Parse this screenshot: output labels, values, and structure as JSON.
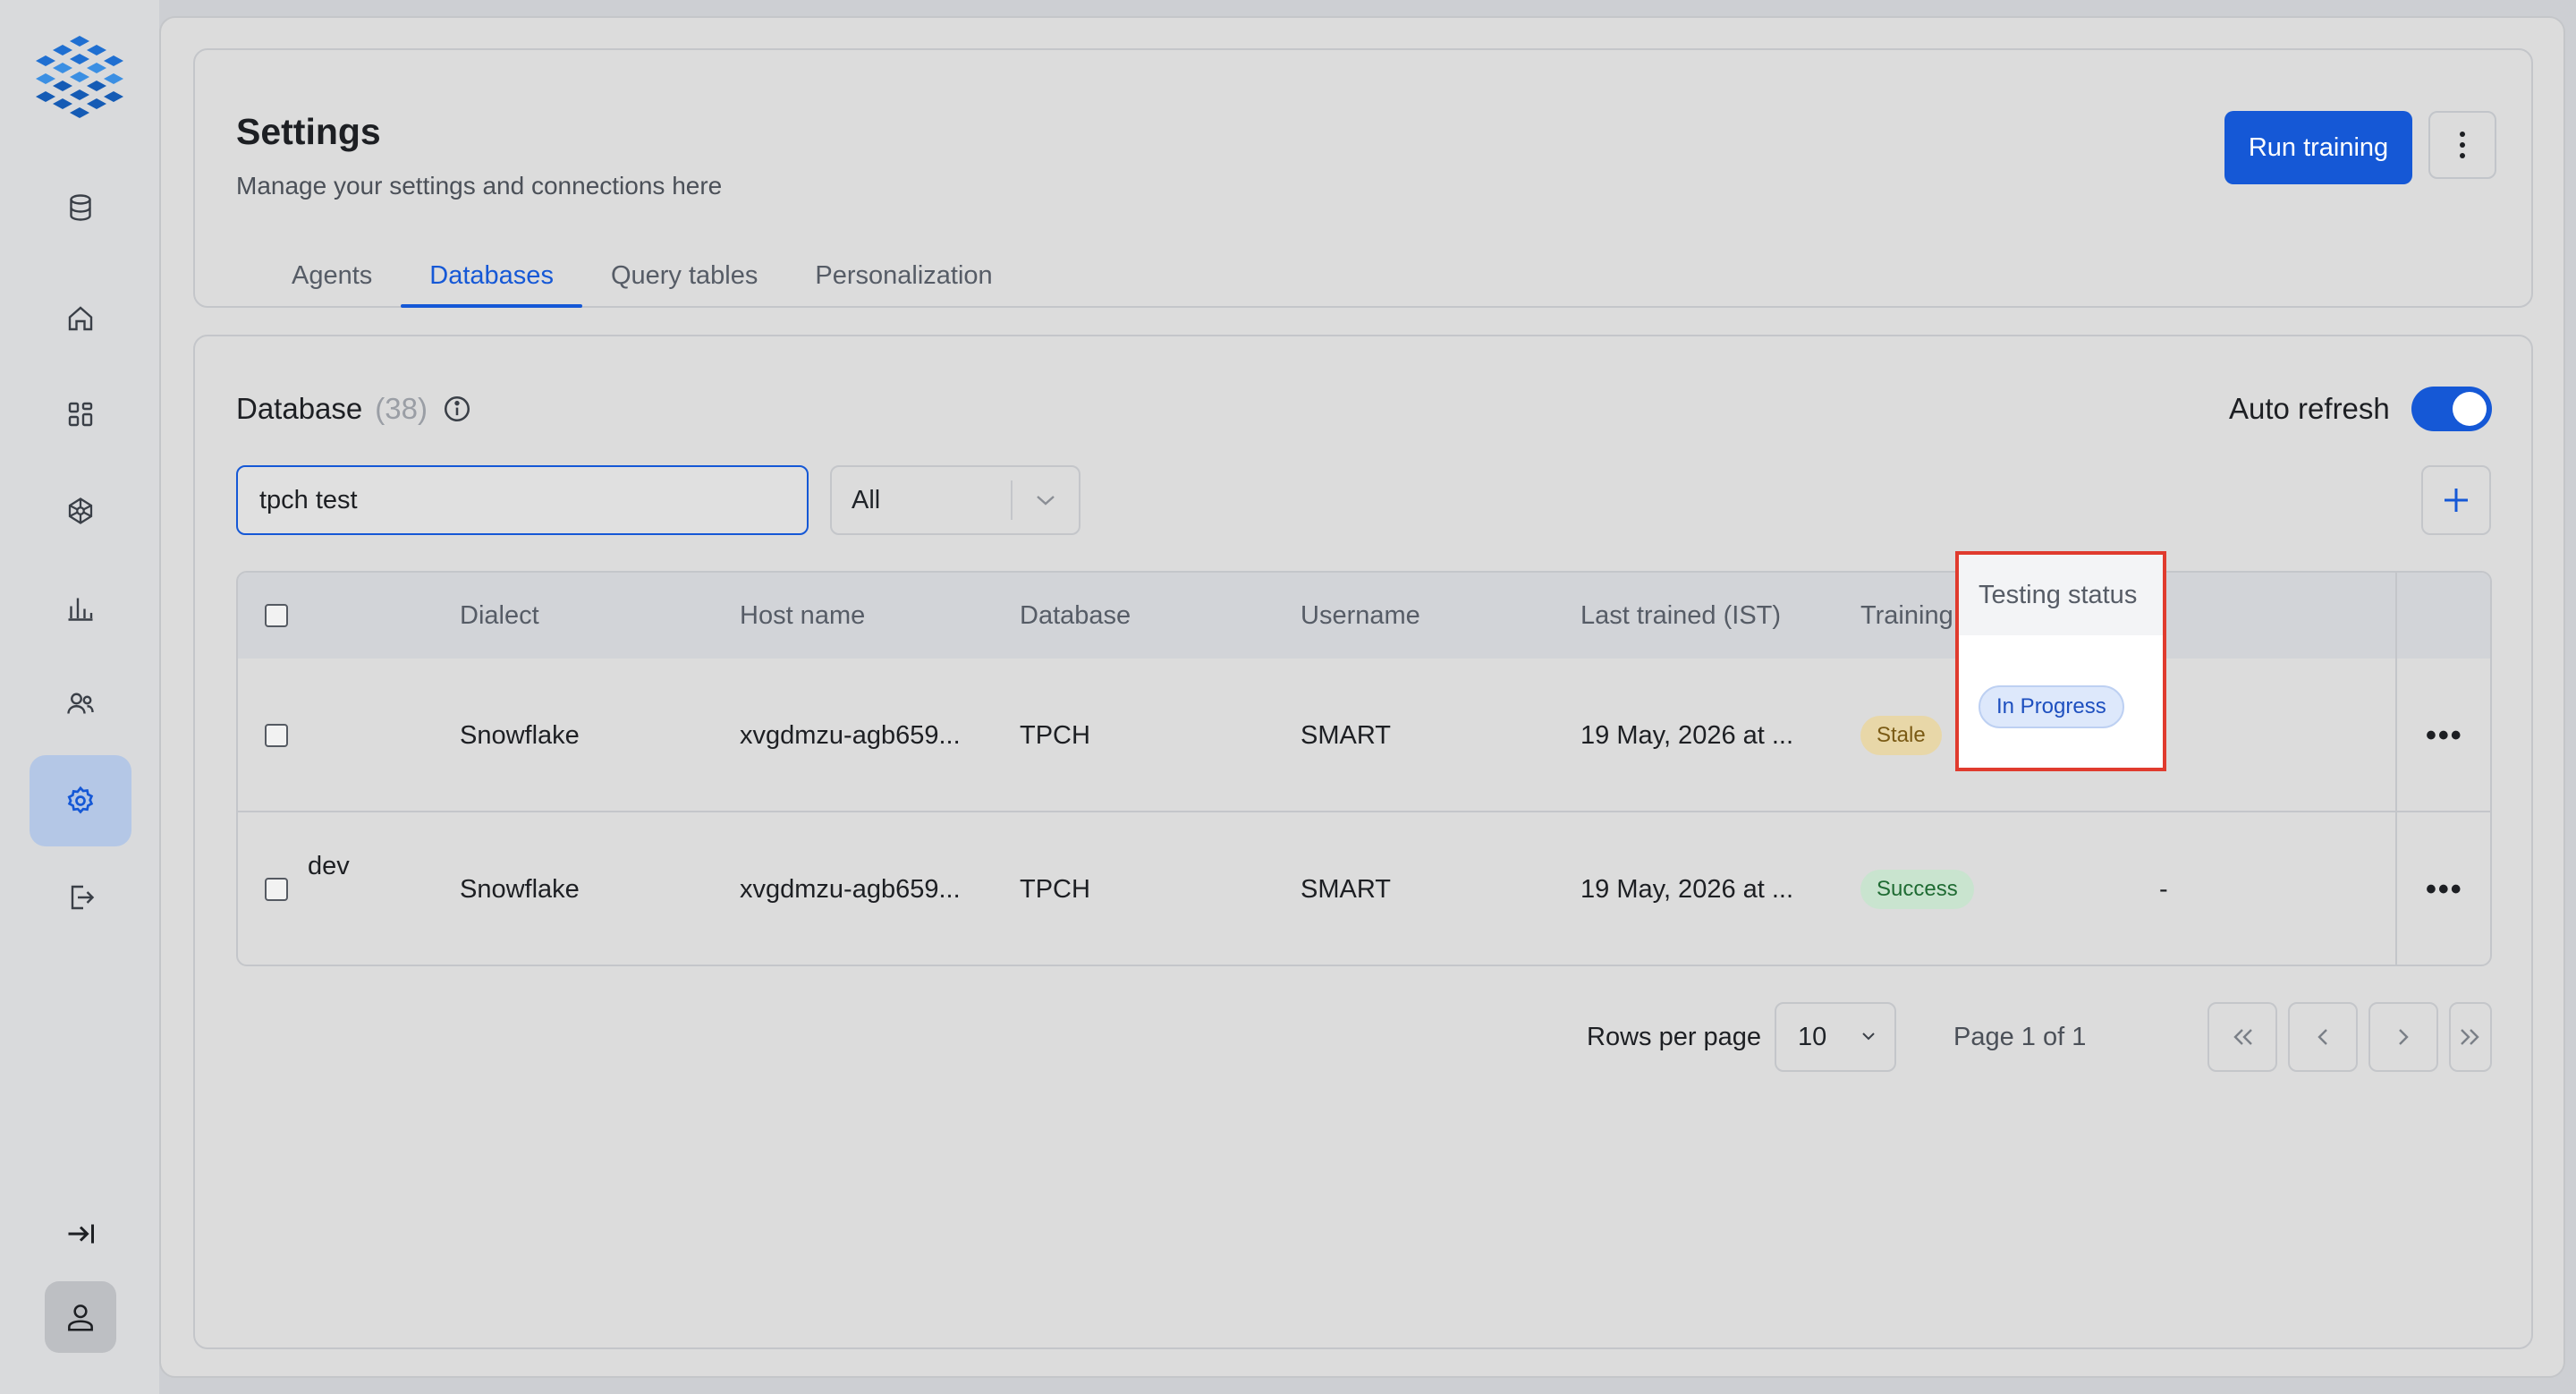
{
  "sidebar": {
    "items": [
      {
        "name": "database-icon"
      },
      {
        "name": "home-icon"
      },
      {
        "name": "dashboard-icon"
      },
      {
        "name": "network-icon"
      },
      {
        "name": "chart-icon"
      },
      {
        "name": "users-icon"
      },
      {
        "name": "settings-icon",
        "active": true
      },
      {
        "name": "logout-icon"
      }
    ],
    "collapse_icon": "collapse-icon",
    "user_icon": "user-icon"
  },
  "header": {
    "title": "Settings",
    "subtitle": "Manage your settings and connections here",
    "run_button": "Run training"
  },
  "tabs": [
    {
      "label": "Agents"
    },
    {
      "label": "Databases",
      "active": true
    },
    {
      "label": "Query tables"
    },
    {
      "label": "Personalization"
    }
  ],
  "database_section": {
    "title": "Database",
    "count": "(38)",
    "auto_refresh_label": "Auto refresh",
    "auto_refresh_on": true,
    "search_value": "tpch test",
    "filter_value": "All"
  },
  "table": {
    "columns": [
      "Dialect",
      "Host name",
      "Database",
      "Username",
      "Last trained (IST)",
      "Training status",
      "Testing status"
    ],
    "rows": [
      {
        "name_fragment": "",
        "dialect": "Snowflake",
        "host": "xvgdmzu-agb659...",
        "database": "TPCH",
        "username": "SMART",
        "last_trained": "19 May, 2026 at ...",
        "training_status": "Stale",
        "testing_status": "In Progress"
      },
      {
        "name_fragment": "dev",
        "dialect": "Snowflake",
        "host": "xvgdmzu-agb659...",
        "database": "TPCH",
        "username": "SMART",
        "last_trained": "19 May, 2026 at ...",
        "training_status": "Success",
        "testing_status": "-"
      }
    ]
  },
  "pagination": {
    "rows_per_page_label": "Rows per page",
    "rows_per_page": "10",
    "page_info": "Page 1 of 1"
  },
  "colors": {
    "accent": "#1558d6",
    "highlight": "#e03b2e",
    "stale": "#e8d7a8",
    "success": "#c9e4cf",
    "in_progress": "#dde8fb"
  }
}
